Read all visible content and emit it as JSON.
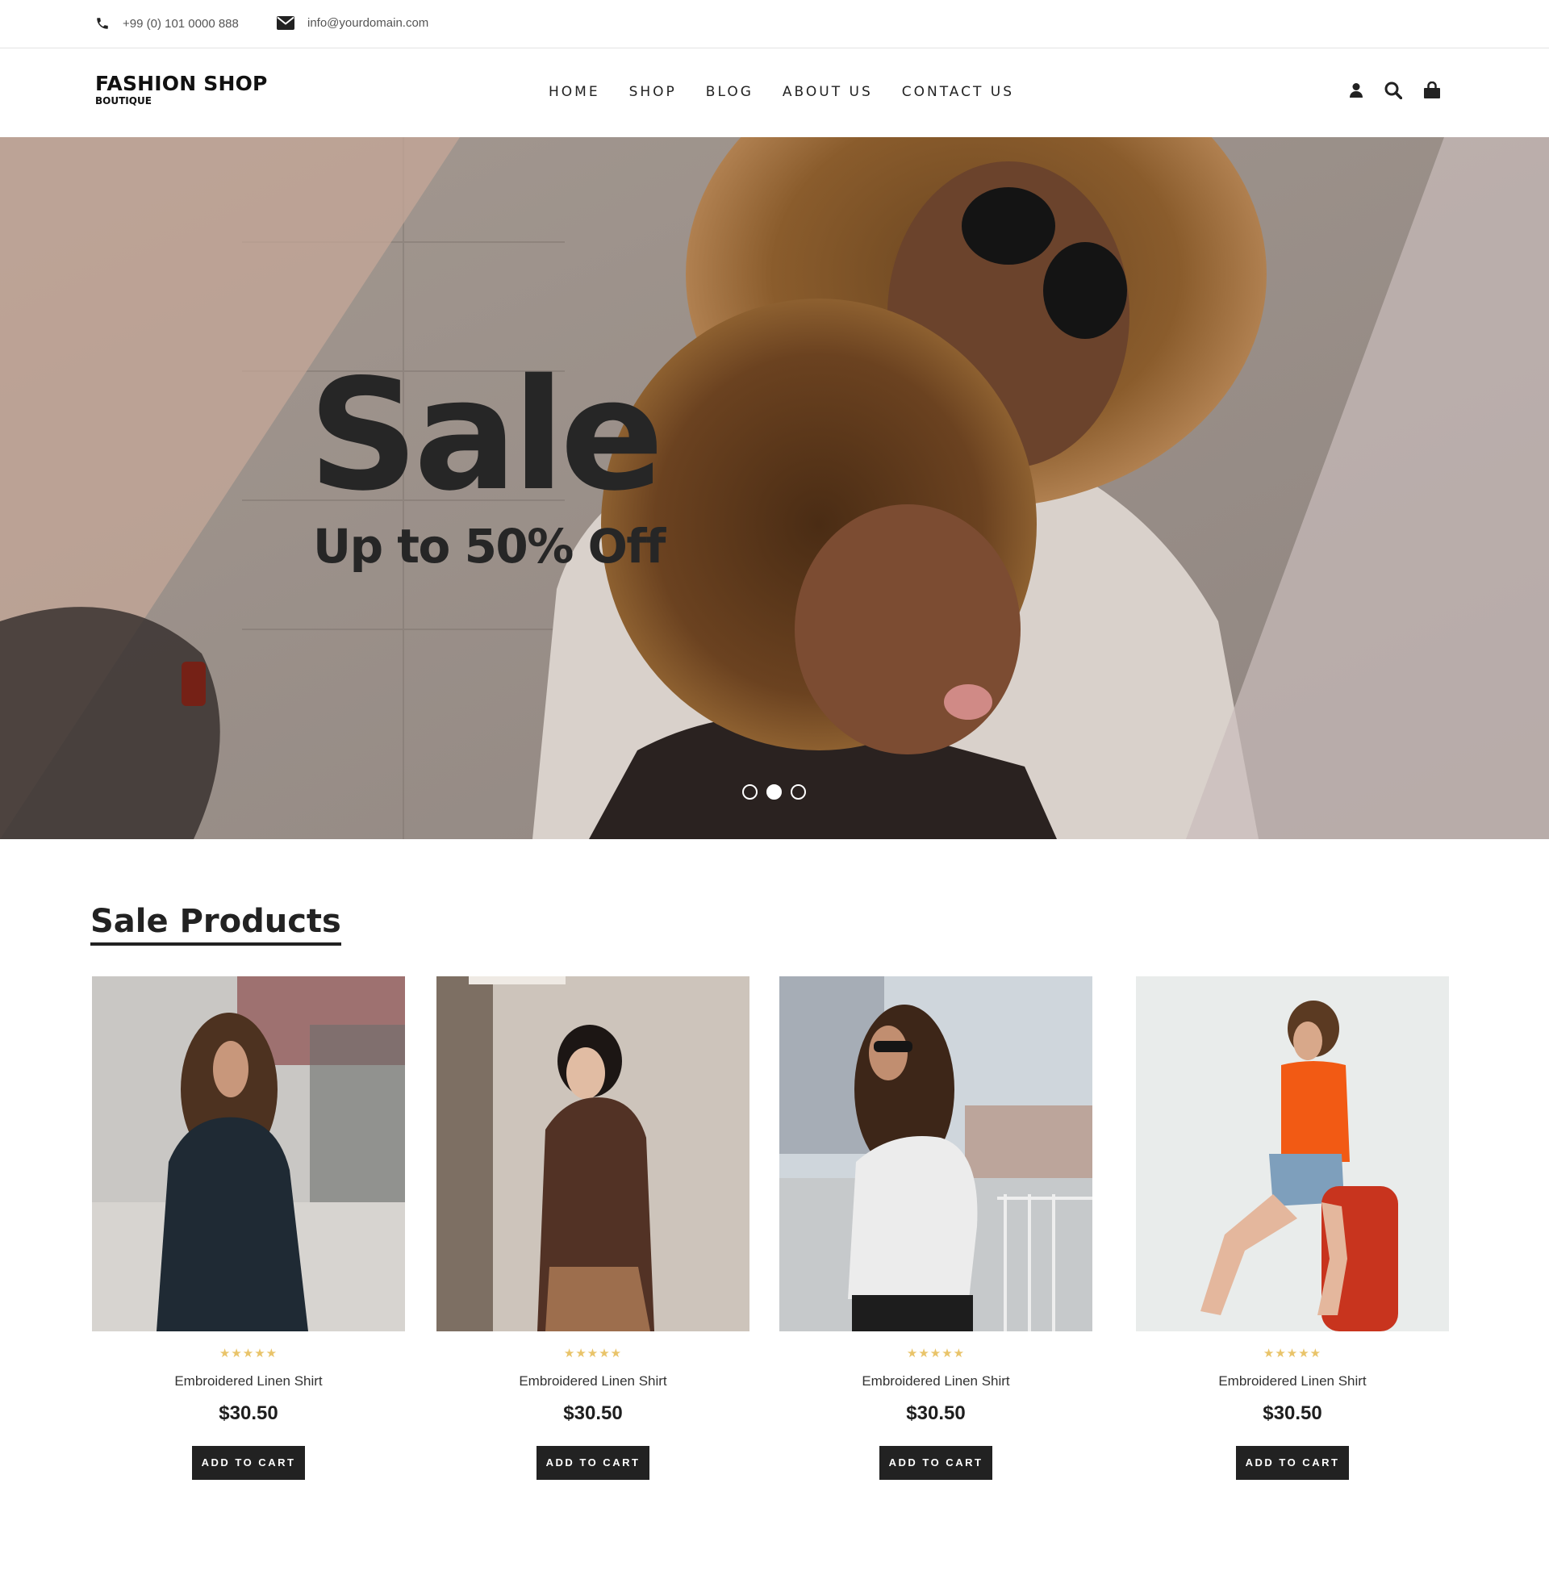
{
  "topbar": {
    "phone": "+99 (0) 101 0000 888",
    "email": "info@yourdomain.com"
  },
  "header": {
    "brand": "FASHION SHOP",
    "tagline": "BOUTIQUE",
    "nav": [
      "HOME",
      "SHOP",
      "BLOG",
      "ABOUT US",
      "CONTACT US"
    ],
    "icons": [
      "user-icon",
      "search-icon",
      "shopping-bag-icon"
    ]
  },
  "hero": {
    "title": "Sale",
    "subtitle": "Up to 50% Off",
    "slides_count": 3,
    "active_slide": 2
  },
  "sale_section": {
    "title": "Sale Products",
    "products": [
      {
        "name": "Embroidered Linen Shirt",
        "price": "$30.50",
        "rating": 5,
        "stars": "★★★★★",
        "button": "ADD TO CART"
      },
      {
        "name": "Embroidered Linen Shirt",
        "price": "$30.50",
        "rating": 5,
        "stars": "★★★★★",
        "button": "ADD TO CART"
      },
      {
        "name": "Embroidered Linen Shirt",
        "price": "$30.50",
        "rating": 5,
        "stars": "★★★★★",
        "button": "ADD TO CART"
      },
      {
        "name": "Embroidered Linen Shirt",
        "price": "$30.50",
        "rating": 5,
        "stars": "★★★★★",
        "button": "ADD TO CART"
      }
    ]
  },
  "colors": {
    "dark": "#222222",
    "star": "#e9c46a",
    "hero_overlay_left": "#c6a898",
    "hero_overlay_right": "#c9bcbb"
  }
}
